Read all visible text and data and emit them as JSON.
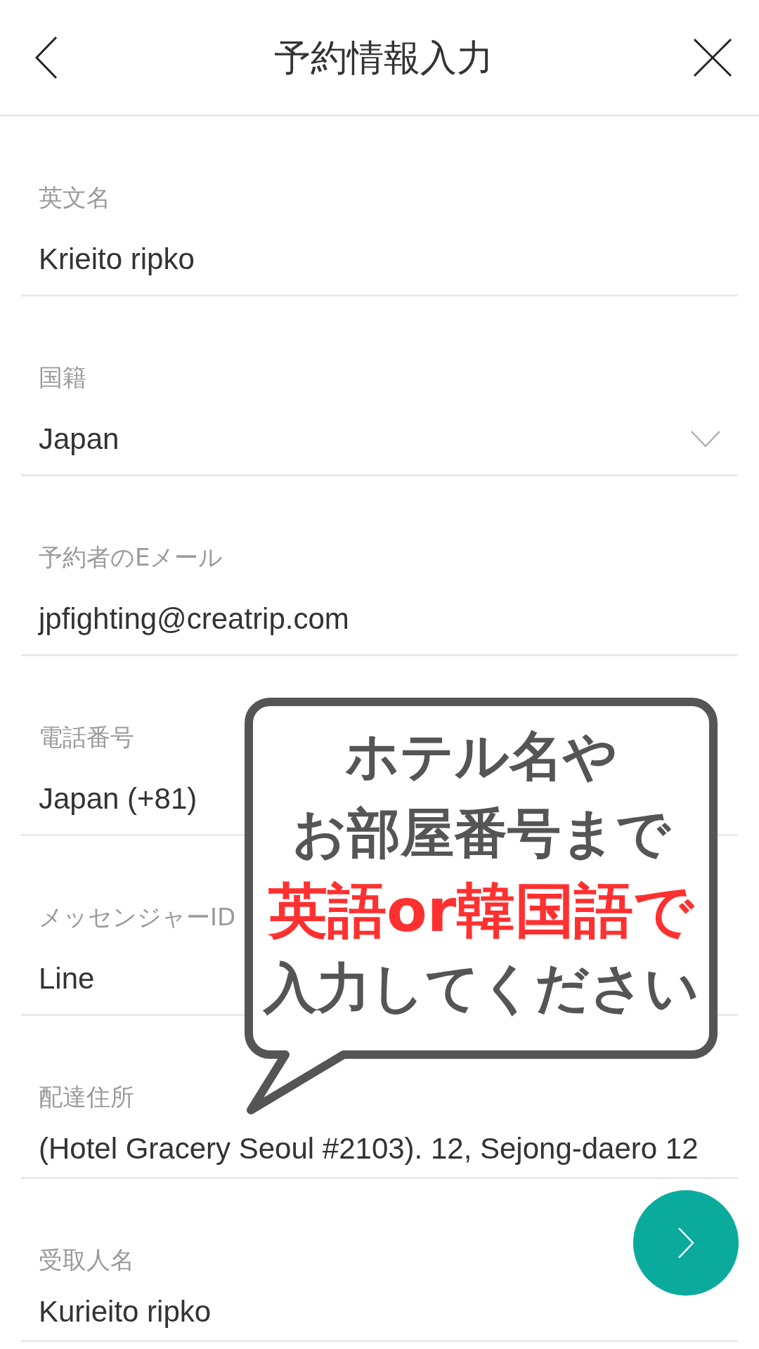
{
  "header": {
    "title": "予約情報入力"
  },
  "fields": [
    {
      "label": "英文名",
      "value": "Krieito ripko",
      "kind": "text"
    },
    {
      "label": "国籍",
      "value": "Japan",
      "kind": "select"
    },
    {
      "label": "予約者のEメール",
      "value": "jpfighting@creatrip.com",
      "kind": "text"
    },
    {
      "label": "電話番号",
      "value": "Japan (+81)",
      "kind": "text"
    },
    {
      "label": "メッセンジャーID",
      "value": "Line",
      "kind": "text"
    },
    {
      "label": "配達住所",
      "value": "(Hotel Gracery Seoul #2103). 12, Sejong-daero 12",
      "kind": "text"
    },
    {
      "label": "受取人名",
      "value": "Kurieito ripko",
      "kind": "text"
    }
  ],
  "callout": {
    "lines": [
      {
        "text": "ホテル名や",
        "emphasis": false
      },
      {
        "text": "お部屋番号まで",
        "emphasis": false
      },
      {
        "text": "英語or韓国語で",
        "emphasis": true
      },
      {
        "text": "入力してください",
        "emphasis": false
      }
    ]
  }
}
